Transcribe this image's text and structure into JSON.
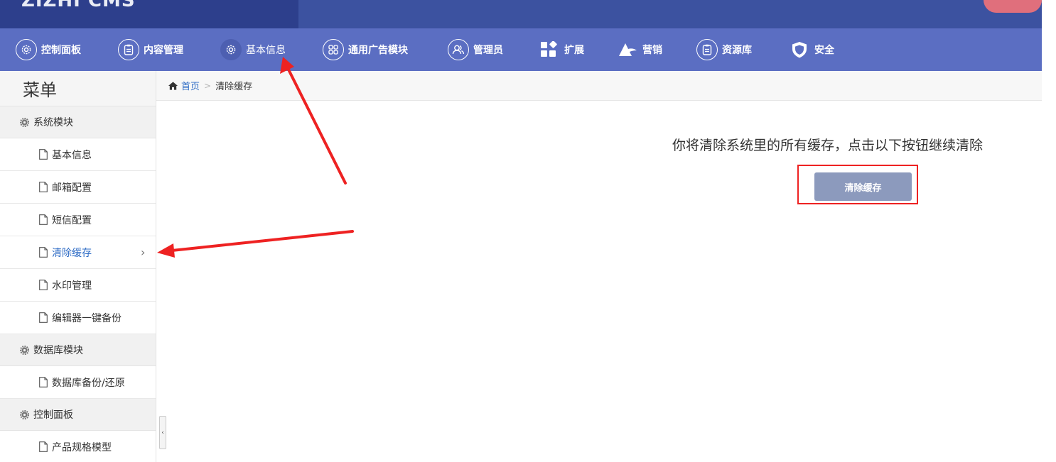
{
  "header": {
    "logo_text": "ZIZHI CMS",
    "accent_color": "#3c52a0",
    "nav_color": "#5b6ec2"
  },
  "nav": {
    "items": [
      {
        "label": "控制面板",
        "icon": "gear-icon"
      },
      {
        "label": "内容管理",
        "icon": "clipboard-icon"
      },
      {
        "label": "基本信息",
        "icon": "gear-icon"
      },
      {
        "label": "通用广告模块",
        "icon": "grid-icon"
      },
      {
        "label": "管理员",
        "icon": "users-icon"
      },
      {
        "label": "扩展",
        "icon": "blocks-icon"
      },
      {
        "label": "营销",
        "icon": "megaphone-icon"
      },
      {
        "label": "资源库",
        "icon": "clipboard-icon"
      },
      {
        "label": "安全",
        "icon": "shield-icon"
      }
    ],
    "active_index": 2
  },
  "sidebar": {
    "title": "菜单",
    "groups": [
      {
        "label": "系统模块",
        "items": [
          "基本信息",
          "邮箱配置",
          "短信配置",
          "清除缓存",
          "水印管理",
          "编辑器一键备份"
        ]
      },
      {
        "label": "数据库模块",
        "items": [
          "数据库备份/还原"
        ]
      },
      {
        "label": "控制面板",
        "items": [
          "产品规格模型"
        ]
      }
    ],
    "active_item": "清除缓存",
    "collapse_glyph": "‹"
  },
  "breadcrumb": {
    "home": "首页",
    "current": "清除缓存"
  },
  "main": {
    "notice": "你将清除系统里的所有缓存，点击以下按钮继续清除",
    "button_label": "清除缓存",
    "button_color": "#8c9abd"
  },
  "annotations": {
    "arrow_color": "#ee2222",
    "box_color": "#ee2222"
  }
}
